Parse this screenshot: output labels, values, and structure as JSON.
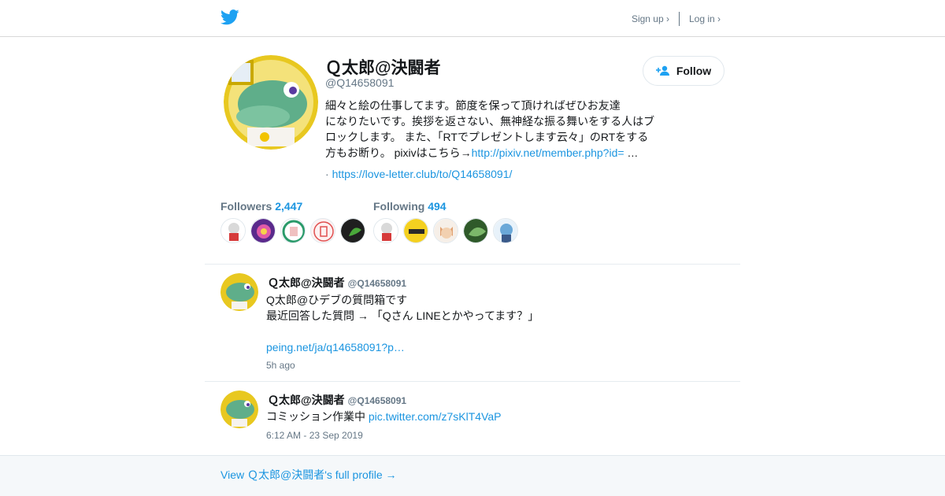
{
  "colors": {
    "accent": "#1b95e0",
    "muted": "#657786",
    "footer_bg": "#f5f8fa"
  },
  "topbar": {
    "logo_icon": "twitter-bird-icon",
    "signup_label": "Sign up ›",
    "login_label": "Log in ›"
  },
  "profile": {
    "name": "Ｑ太郎@決闘者",
    "handle": "@Q14658091",
    "bio_line1": "細々と絵の仕事してます。節度を保って頂ければぜひお友達",
    "bio_line2": "になりたいです。挨拶を返さない、無神経な振る舞いをする人はブ",
    "bio_line3": "ロックします。 また、「RTでプレゼントします云々」のRTをする",
    "bio_line4_text": "方もお断り。 pixivはこちら→",
    "bio_link": "http://pixiv.net/member.php?id=",
    "bio_ellipsis": " …",
    "url_prefix": "· ",
    "url": "https://love-letter.club/to/Q14658091/",
    "follow_label": "Follow",
    "follow_icon": "add-user-icon"
  },
  "stats": {
    "followers_label": "Followers",
    "followers_count": "2,447",
    "following_label": "Following",
    "following_count": "494"
  },
  "tweets": [
    {
      "name": "Ｑ太郎@決闘者",
      "handle": "@Q14658091",
      "line1": "Q太郎@ひデブの質問箱です",
      "line2": "最近回答した質問 → 「Qさん LINEとかやってます？」",
      "link": "peing.net/ja/q14658091?p…",
      "time": "5h ago"
    },
    {
      "name": "Ｑ太郎@決闘者",
      "handle": "@Q14658091",
      "text": "コミッション作業中 ",
      "link": "pic.twitter.com/z7sKlT4VaP",
      "time": "6:12 AM - 23 Sep 2019"
    }
  ],
  "footer": {
    "link_label": "View Ｑ太郎@決闘者's full profile →"
  }
}
